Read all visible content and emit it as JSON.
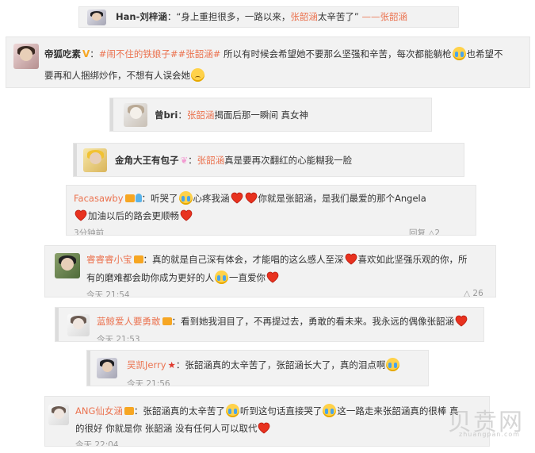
{
  "comments": [
    {
      "user": "Han-刘梓涵",
      "parts": [
        {
          "t": "text",
          "v": "："
        },
        {
          "t": "text",
          "v": "“身上重担很多，一路以来，"
        },
        {
          "t": "hl",
          "v": "张韶涵"
        },
        {
          "t": "text",
          "v": "太辛苦了”"
        },
        {
          "t": "hl",
          "v": " ——张韶涵"
        }
      ]
    },
    {
      "user": "帝狐吃素",
      "badge": "V",
      "line1": [
        {
          "t": "text",
          "v": "："
        },
        {
          "t": "hl",
          "v": "#闹不住的铁娘子#"
        },
        {
          "t": "hl",
          "v": "#张韶涵#"
        },
        {
          "t": "text",
          "v": " 所以有时候会希望她不要那么坚强和辛苦，每次都能躺枪"
        },
        {
          "t": "emoji",
          "v": "cry"
        },
        {
          "t": "text",
          "v": "也希望不"
        }
      ],
      "line2": [
        {
          "t": "text",
          "v": "要再和人捆绑炒作，不想有人误会她"
        },
        {
          "t": "emoji",
          "v": "sad"
        }
      ]
    },
    {
      "user": "曾bri",
      "parts": [
        {
          "t": "text",
          "v": "："
        },
        {
          "t": "hl",
          "v": "张韶涵"
        },
        {
          "t": "text",
          "v": "揭面后那一瞬间 真女神"
        }
      ]
    },
    {
      "user": "金角大王有包子",
      "parts": [
        {
          "t": "text",
          "v": "："
        },
        {
          "t": "hl",
          "v": "张韶涵"
        },
        {
          "t": "text",
          "v": "真是要再次翻红的心能糊我一脸"
        }
      ]
    },
    {
      "user": "Facasawby",
      "line1": [
        {
          "t": "text",
          "v": "：听哭了"
        },
        {
          "t": "emoji",
          "v": "cry"
        },
        {
          "t": "text",
          "v": "心疼我涵"
        },
        {
          "t": "heart"
        },
        {
          "t": "heart"
        },
        {
          "t": "text",
          "v": "你就是张韶涵，是我们最爱的那个Angela"
        }
      ],
      "line2": [
        {
          "t": "heart"
        },
        {
          "t": "text",
          "v": "加油以后的路会更顺畅"
        },
        {
          "t": "heart"
        }
      ],
      "time": "3分钟前",
      "actions": "回复  △2"
    },
    {
      "user": "睿睿睿小宝",
      "line1": [
        {
          "t": "text",
          "v": "：真的就是自己深有体会，才能唱的这么感人至深"
        },
        {
          "t": "heart"
        },
        {
          "t": "text",
          "v": "喜欢如此坚强乐观的你，所"
        }
      ],
      "line2": [
        {
          "t": "text",
          "v": "有的磨难都会助你成为更好的人"
        },
        {
          "t": "emoji",
          "v": "cry"
        },
        {
          "t": "text",
          "v": "一直爱你"
        },
        {
          "t": "heart"
        }
      ],
      "time": "今天 21:54",
      "actions": "△ 26"
    },
    {
      "user": "蓝鲸爱人要勇敢",
      "parts": [
        {
          "t": "text",
          "v": "：看到她我泪目了，不再提过去，勇敢的看未来。我永远的偶像张韶涵"
        },
        {
          "t": "heart"
        }
      ],
      "time": "今天 21:53"
    },
    {
      "user": "吴凯Jerry",
      "parts": [
        {
          "t": "text",
          "v": "：张韶涵真的太辛苦了，张韶涵长大了，真的泪点啊"
        },
        {
          "t": "emoji",
          "v": "cry"
        }
      ],
      "time": "今天 21:56"
    },
    {
      "user": "ANG仙女涵",
      "line1": [
        {
          "t": "text",
          "v": "：张韶涵真的太辛苦了"
        },
        {
          "t": "emoji",
          "v": "cry"
        },
        {
          "t": "text",
          "v": "听到这句话直接哭了"
        },
        {
          "t": "emoji",
          "v": "cry"
        },
        {
          "t": "text",
          "v": "这一路走来张韶涵真的很棒 真"
        }
      ],
      "line2": [
        {
          "t": "text",
          "v": "的很好 你就是你 张韶涵 没有任何人可以取代"
        },
        {
          "t": "heart"
        }
      ],
      "time": "今天 22:04"
    }
  ],
  "watermark": {
    "text": "贝贲网",
    "url": "zhuangpan.com"
  },
  "colors": {
    "accent": "#eb7350",
    "heart": "#e8321f",
    "emoji": "#ffd24a"
  }
}
